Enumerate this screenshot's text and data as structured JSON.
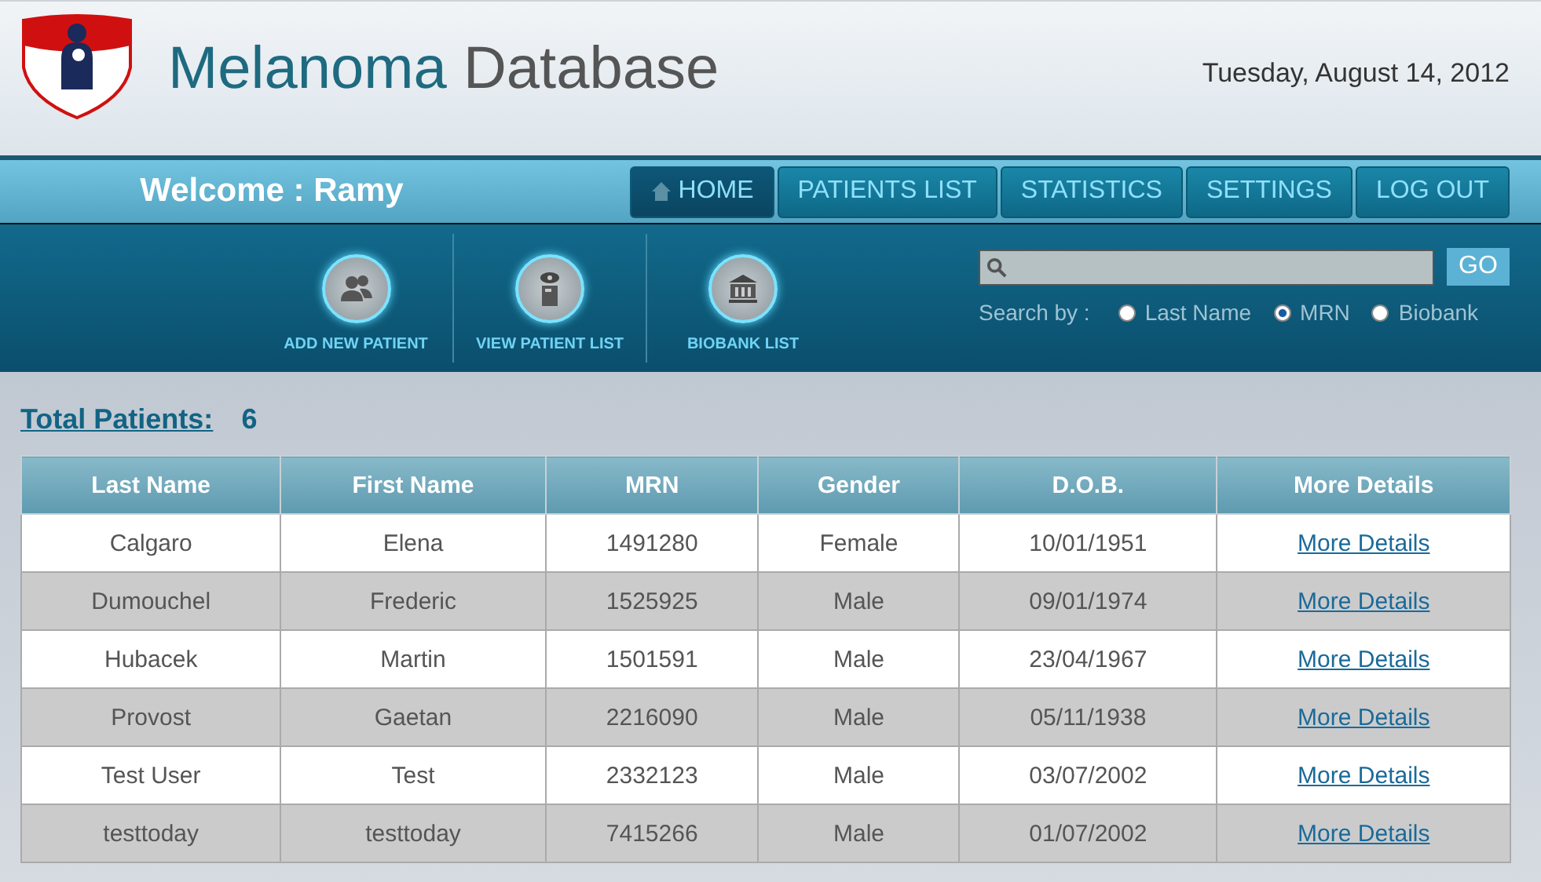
{
  "header": {
    "title_part1": "Melanoma",
    "title_part2": "Database",
    "date": "Tuesday, August 14, 2012"
  },
  "welcome": "Welcome : Ramy",
  "nav": [
    {
      "label": "HOME",
      "selected": true
    },
    {
      "label": "PATIENTS LIST",
      "selected": false
    },
    {
      "label": "STATISTICS",
      "selected": false
    },
    {
      "label": "SETTINGS",
      "selected": false
    },
    {
      "label": "LOG OUT",
      "selected": false
    }
  ],
  "tools": [
    {
      "kind": "people",
      "label": "ADD NEW PATIENT"
    },
    {
      "kind": "eye-doc",
      "label": "VIEW PATIENT LIST"
    },
    {
      "kind": "bank",
      "label": "BIOBANK LIST"
    }
  ],
  "search": {
    "button": "GO",
    "search_by_label": "Search by :",
    "options": [
      {
        "label": "Last Name",
        "selected": false
      },
      {
        "label": "MRN",
        "selected": true
      },
      {
        "label": "Biobank",
        "selected": false
      }
    ]
  },
  "total": {
    "label": "Total Patients:",
    "value": "6"
  },
  "table": {
    "columns": [
      "Last Name",
      "First Name",
      "MRN",
      "Gender",
      "D.O.B.",
      "More Details"
    ],
    "rows": [
      [
        "Calgaro",
        "Elena",
        "1491280",
        "Female",
        "10/01/1951",
        "More Details"
      ],
      [
        "Dumouchel",
        "Frederic",
        "1525925",
        "Male",
        "09/01/1974",
        "More Details"
      ],
      [
        "Hubacek",
        "Martin",
        "1501591",
        "Male",
        "23/04/1967",
        "More Details"
      ],
      [
        "Provost",
        "Gaetan",
        "2216090",
        "Male",
        "05/11/1938",
        "More Details"
      ],
      [
        "Test User",
        "Test",
        "2332123",
        "Male",
        "03/07/2002",
        "More Details"
      ],
      [
        "testtoday",
        "testtoday",
        "7415266",
        "Male",
        "01/07/2002",
        "More Details"
      ]
    ]
  }
}
